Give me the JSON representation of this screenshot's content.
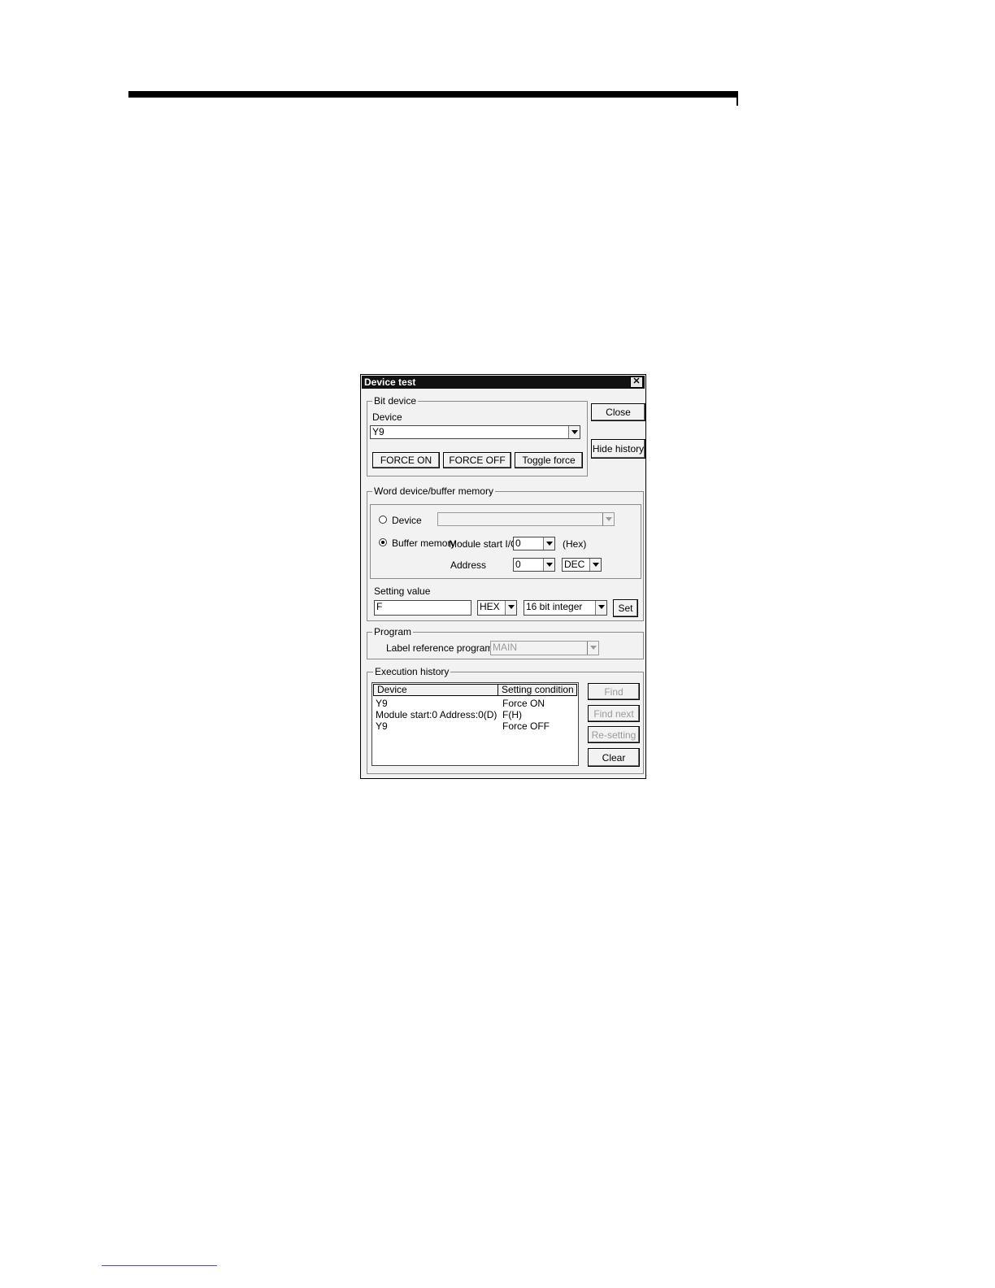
{
  "dialog": {
    "title": "Device test",
    "close_label": "Close",
    "hide_history_label": "Hide history"
  },
  "bit_device": {
    "group_title": "Bit device",
    "device_label": "Device",
    "device_value": "Y9",
    "force_on_label": "FORCE ON",
    "force_off_label": "FORCE OFF",
    "toggle_force_label": "Toggle force"
  },
  "word_device": {
    "group_title": "Word device/buffer memory",
    "device_radio_label": "Device",
    "device_value": "",
    "buffer_memory_label": "Buffer memory",
    "module_start_label": "Module start I/O",
    "module_start_value": "0",
    "hex_label": "(Hex)",
    "address_label": "Address",
    "address_value": "0",
    "address_format": "DEC",
    "setting_value_label": "Setting value",
    "setting_value": "F",
    "value_format": "HEX",
    "value_type": "16 bit integer",
    "set_label": "Set"
  },
  "program": {
    "group_title": "Program",
    "label_reference_label": "Label reference program",
    "label_reference_value": "MAIN"
  },
  "history": {
    "group_title": "Execution history",
    "columns": [
      "Device",
      "Setting condition"
    ],
    "rows": [
      [
        "Y9",
        "Force ON"
      ],
      [
        "Module start:0 Address:0(D)",
        "F(H)"
      ],
      [
        "Y9",
        "Force OFF"
      ]
    ],
    "find_label": "Find",
    "find_next_label": "Find next",
    "resetting_label": "Re-setting",
    "clear_label": "Clear"
  },
  "icons": {
    "close": "close-icon",
    "dropdown": "chevron-down-icon",
    "radio": "radio-icon"
  }
}
